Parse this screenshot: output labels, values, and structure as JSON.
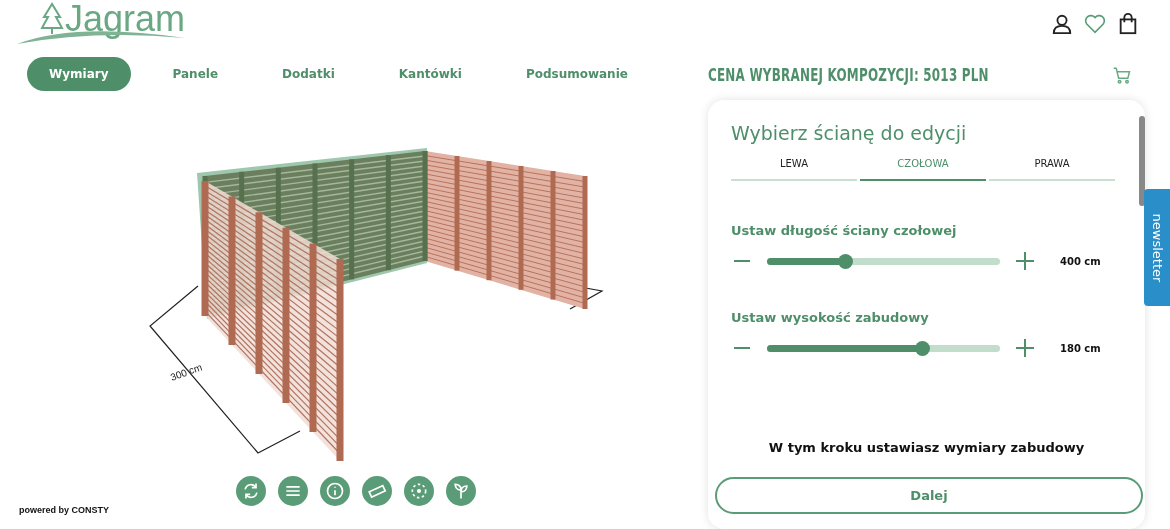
{
  "brand": {
    "name": "Jagram"
  },
  "steps": [
    {
      "label": "Wymiary",
      "selected": true
    },
    {
      "label": "Panele",
      "selected": false
    },
    {
      "label": "Dodatki",
      "selected": false
    },
    {
      "label": "Kantówki",
      "selected": false
    },
    {
      "label": "Podsumowanie",
      "selected": false
    }
  ],
  "viewer": {
    "dimension_label": "300 cm",
    "powered_by": "powered by CONSTY"
  },
  "toolbar": [
    {
      "kind": "rotate"
    },
    {
      "kind": "menu"
    },
    {
      "kind": "info"
    },
    {
      "kind": "ruler"
    },
    {
      "kind": "focus"
    },
    {
      "kind": "plant"
    }
  ],
  "price": "CENA WYBRANEJ KOMPOZYCJI: 5013 PLN",
  "panel": {
    "title": "Wybierz ścianę do edycji",
    "walls": [
      {
        "label": "LEWA",
        "selected": false
      },
      {
        "label": "CZOŁOWA",
        "selected": true
      },
      {
        "label": "PRAWA",
        "selected": false
      }
    ],
    "sliders": [
      {
        "label": "Ustaw długość ściany czołowej",
        "level": 0.335,
        "reading": "400 cm"
      },
      {
        "label": "Ustaw wysokość zabudowy",
        "level": 0.665,
        "reading": "180 cm"
      }
    ],
    "hint": "W tym kroku ustawiasz wymiary zabudowy",
    "next": "Dalej"
  },
  "newsletter": "newsletter"
}
